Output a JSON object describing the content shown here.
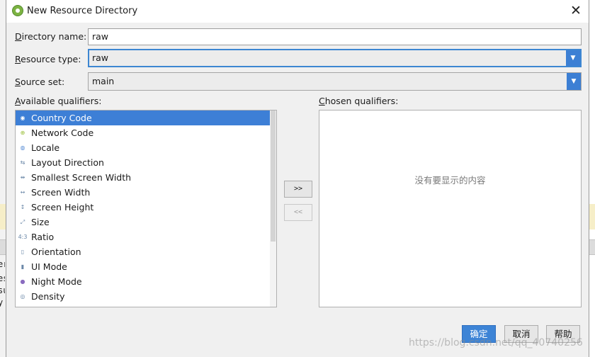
{
  "dialog": {
    "title": "New Resource Directory"
  },
  "form": {
    "directory_name": {
      "label_first": "D",
      "label_rest": "irectory name:",
      "value": "raw"
    },
    "resource_type": {
      "label_first": "R",
      "label_rest": "esource type:",
      "value": "raw"
    },
    "source_set": {
      "label_first": "S",
      "label_rest": "ource set:",
      "value": "main"
    }
  },
  "available": {
    "label_first": "A",
    "label_rest": "vailable qualifiers:",
    "items": [
      {
        "label": "Country Code",
        "icon": "globe-flag-icon",
        "color": "#e0a030"
      },
      {
        "label": "Network Code",
        "icon": "network-icon",
        "color": "#9bbf3a"
      },
      {
        "label": "Locale",
        "icon": "globe-icon",
        "color": "#5b8fd6"
      },
      {
        "label": "Layout Direction",
        "icon": "layout-direction-icon",
        "color": "#6b88a8"
      },
      {
        "label": "Smallest Screen Width",
        "icon": "smallest-width-icon",
        "color": "#6b88a8"
      },
      {
        "label": "Screen Width",
        "icon": "screen-width-icon",
        "color": "#6b88a8"
      },
      {
        "label": "Screen Height",
        "icon": "screen-height-icon",
        "color": "#6b88a8"
      },
      {
        "label": "Size",
        "icon": "size-icon",
        "color": "#6b88a8"
      },
      {
        "label": "Ratio",
        "icon": "ratio-icon",
        "color": "#6b88a8"
      },
      {
        "label": "Orientation",
        "icon": "orientation-icon",
        "color": "#6b88a8"
      },
      {
        "label": "UI Mode",
        "icon": "ui-mode-icon",
        "color": "#6b88a8"
      },
      {
        "label": "Night Mode",
        "icon": "night-mode-icon",
        "color": "#8a6bbf"
      },
      {
        "label": "Density",
        "icon": "density-icon",
        "color": "#6b88a8"
      }
    ],
    "selected_index": 0
  },
  "chosen": {
    "label_first": "C",
    "label_rest": "hosen qualifiers:",
    "empty_text": "没有要显示的内容"
  },
  "move_buttons": {
    "add": ">>",
    "remove": "<<"
  },
  "buttons": {
    "ok": "确定",
    "cancel": "取消",
    "help": "帮助"
  },
  "background": {
    "left_letters": [
      "er",
      "es",
      "su",
      "y"
    ]
  },
  "watermark": "https://blog.csdn.net/qq_40740256",
  "colors": {
    "accent": "#3d7fd6",
    "selection": "#3d7fd6"
  }
}
